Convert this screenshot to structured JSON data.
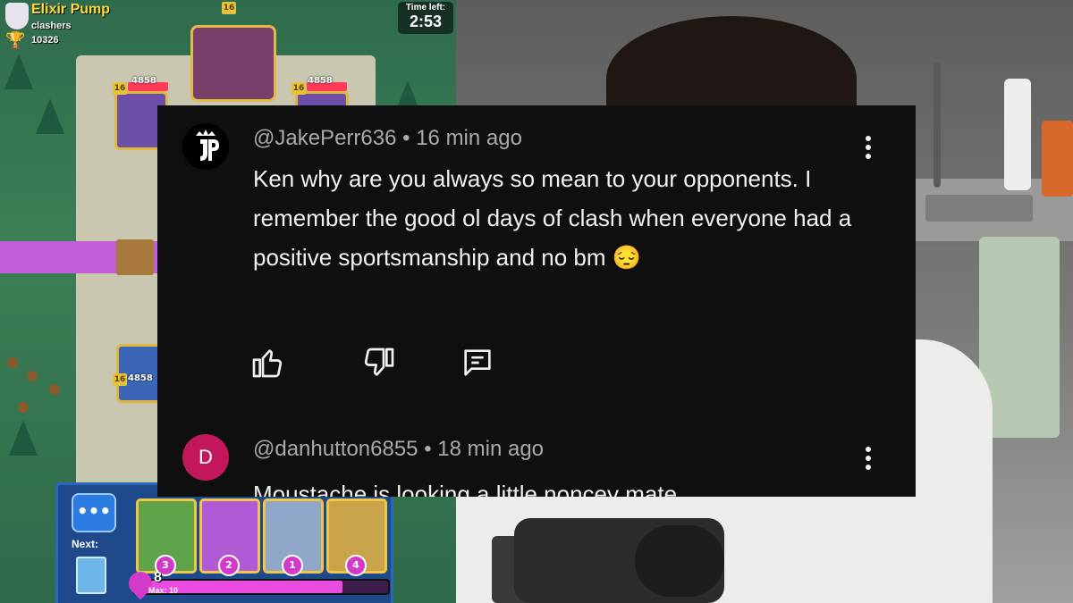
{
  "game": {
    "mode_title": "Elixir Pump",
    "clan_name": "clashers",
    "trophies": "10326",
    "time_label": "Time left:",
    "time_value": "2:53",
    "tower_level": "16",
    "tower_hp_left": "4858",
    "tower_hp_right": "4858",
    "tower_hp_own": "4858",
    "next_label": "Next:",
    "card_costs": [
      "3",
      "2",
      "1",
      "4"
    ],
    "elixir_count": "8",
    "elixir_max_label": "Max: 10",
    "elixir_fraction": 0.82
  },
  "comments": [
    {
      "author": "@JakePerr636",
      "time": "16 min ago",
      "text": "Ken why are you always so mean to your opponents. I remember the good ol days of clash when everyone had a positive sportsmanship and no bm 😔",
      "avatar_text": "JP"
    },
    {
      "author": "@danhutton6855",
      "time": "18 min ago",
      "text": "Moustache is looking a little noncey mate",
      "avatar_text": "D"
    }
  ],
  "separator": " • ",
  "colors": {
    "comment_bg": "#0f0f0f",
    "avatar_d": "#c2185b",
    "meta_text": "#aaaaaa"
  }
}
